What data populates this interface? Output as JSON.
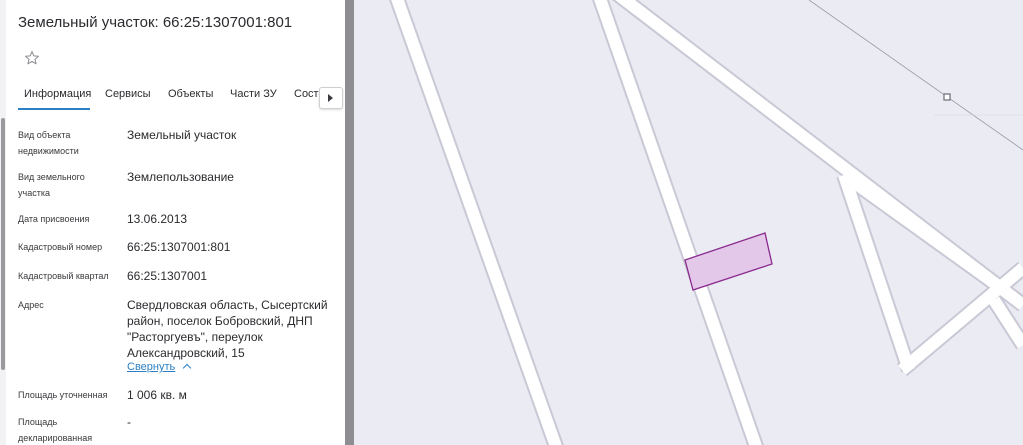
{
  "panel": {
    "title": "Земельный участок: 66:25:1307001:801",
    "tabs": [
      {
        "label": "Информация"
      },
      {
        "label": "Сервисы"
      },
      {
        "label": "Объекты"
      },
      {
        "label": "Части ЗУ"
      },
      {
        "label": "Соста"
      }
    ],
    "fields": [
      {
        "label": "Вид объекта недвижимости",
        "value": "Земельный участок"
      },
      {
        "label": "Вид земельного участка",
        "value": "Землепользование"
      },
      {
        "label": "Дата присвоения",
        "value": "13.06.2013"
      },
      {
        "label": "Кадастровый номер",
        "value": "66:25:1307001:801"
      },
      {
        "label": "Кадастровый квартал",
        "value": "66:25:1307001"
      },
      {
        "label": "Адрес",
        "value": "Свердловская область, Сысертский район, поселок Бобровский, ДНП \"Расторгуевъ\", переулок Александровский, 15"
      },
      {
        "label": "Площадь уточненная",
        "value": "1 006 кв. м"
      },
      {
        "label": "Площадь декларированная",
        "value": "-"
      }
    ],
    "collapse_label": "Свернуть"
  },
  "colors": {
    "accent": "#2b7fc2",
    "map_background": "#ebebf3",
    "parcel_fill": "#e3c8ea",
    "parcel_stroke": "#8a2a8e",
    "road": "#ffffff",
    "road_edge": "#c8c8d4"
  },
  "icons": {
    "favorite": "star-outline-icon",
    "tab_scroll": "chevron-right-icon",
    "collapse": "chevron-up-icon"
  }
}
